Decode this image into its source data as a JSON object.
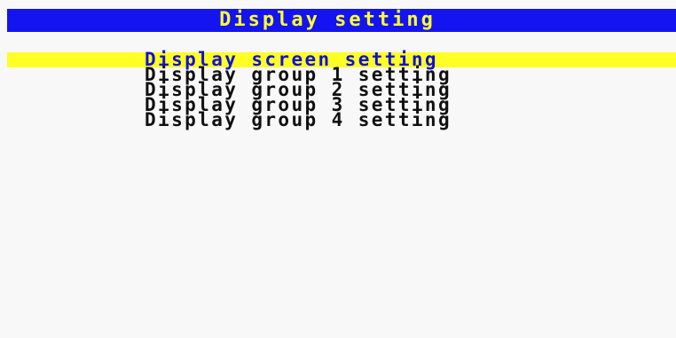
{
  "title": "Display setting",
  "menu": {
    "items": [
      {
        "label": "Display screen setting",
        "selected": true
      },
      {
        "label": "Display group 1 setting",
        "selected": false
      },
      {
        "label": "Display group 2 setting",
        "selected": false
      },
      {
        "label": "Display group 3 setting",
        "selected": false
      },
      {
        "label": "Display group 4 setting",
        "selected": false
      }
    ]
  },
  "colors": {
    "background": "#f8f8f8",
    "title_bar": "#1414f0",
    "title_text": "#ffff30",
    "highlight": "#ffff26",
    "selected_text": "#1010d8",
    "text": "#101010"
  }
}
